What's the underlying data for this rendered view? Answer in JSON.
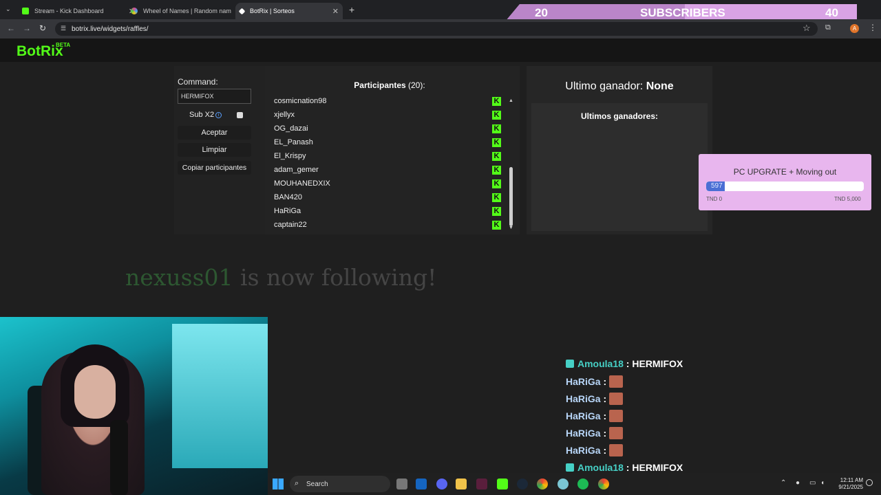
{
  "browser": {
    "tabs": [
      {
        "title": "Stream - Kick Dashboard",
        "color": "#53fc18"
      },
      {
        "title": "Wheel of Names | Random nam",
        "color": "#e04a8f"
      },
      {
        "title": "BotRix | Sorteos",
        "color": "#ffffff"
      }
    ],
    "url": "botrix.live/widgets/raffles/",
    "profile_initial": "A"
  },
  "subscribers_overlay": {
    "current": "20",
    "label": "SUBSCRIBERS",
    "goal": "40"
  },
  "app": {
    "logo": "BotRix",
    "badge": "BETA"
  },
  "raffle": {
    "command_label": "Command:",
    "command_value": "HERMIFOX",
    "sub_multiplier_label": "Sub X2",
    "accept_label": "Aceptar",
    "clear_label": "Limpiar",
    "copy_label": "Copiar participantes",
    "participants_label": "Participantes",
    "participants_count": "(20)",
    "participants_suffix": ":",
    "participants": [
      "cosmicnation98",
      "xjellyx",
      "OG_dazai",
      "EL_Panash",
      "El_Krispy",
      "adam_gemer",
      "MOUHANEDXIX",
      "BAN420",
      "HaRiGa",
      "captain22"
    ],
    "last_winner_label": "Ultimo ganador:",
    "last_winner_value": "None",
    "last_winners_label": "Ultimos ganadores:"
  },
  "goal_widget": {
    "title": "PC UPGRATE + Moving out",
    "current": "597",
    "min": "TND 0",
    "max": "TND 5,000",
    "progress": 0.1194
  },
  "follow_alert": {
    "name": "nexuss01",
    "text": "is now following!"
  },
  "chat": [
    {
      "user": "Amoula18",
      "msg": "HERMIFOX",
      "type": "u1"
    },
    {
      "user": "HaRiGa",
      "msg": "",
      "type": "u2"
    },
    {
      "user": "HaRiGa",
      "msg": "",
      "type": "u2"
    },
    {
      "user": "HaRiGa",
      "msg": "",
      "type": "u2"
    },
    {
      "user": "HaRiGa",
      "msg": "",
      "type": "u2"
    },
    {
      "user": "HaRiGa",
      "msg": "",
      "type": "u2"
    },
    {
      "user": "Amoula18",
      "msg": "HERMIFOX",
      "type": "u1"
    }
  ],
  "taskbar": {
    "search_label": "Search",
    "time": "12:11 AM",
    "date": "9/21/2025"
  }
}
